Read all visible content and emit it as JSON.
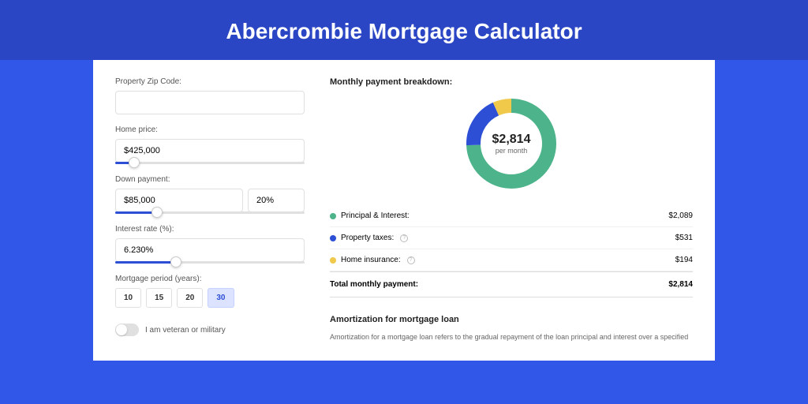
{
  "title": "Abercrombie Mortgage Calculator",
  "form": {
    "zip_label": "Property Zip Code:",
    "zip_value": "",
    "home_price_label": "Home price:",
    "home_price_value": "$425,000",
    "down_payment_label": "Down payment:",
    "down_payment_value": "$85,000",
    "down_payment_pct": "20%",
    "interest_label": "Interest rate (%):",
    "interest_value": "6.230%",
    "period_label": "Mortgage period (years):",
    "periods": [
      "10",
      "15",
      "20",
      "30"
    ],
    "period_selected": "30",
    "veteran_label": "I am veteran or military"
  },
  "breakdown": {
    "title": "Monthly payment breakdown:",
    "amount": "$2,814",
    "per": "per month",
    "items": [
      {
        "label": "Principal & Interest:",
        "value": "$2,089",
        "color": "#4db38a"
      },
      {
        "label": "Property taxes:",
        "value": "$531",
        "color": "#2d4fd6",
        "info": true
      },
      {
        "label": "Home insurance:",
        "value": "$194",
        "color": "#f0c94a",
        "info": true
      }
    ],
    "total_label": "Total monthly payment:",
    "total_value": "$2,814"
  },
  "amort": {
    "title": "Amortization for mortgage loan",
    "text": "Amortization for a mortgage loan refers to the gradual repayment of the loan principal and interest over a specified"
  },
  "chart_data": {
    "type": "pie",
    "title": "Monthly payment breakdown",
    "series": [
      {
        "name": "Principal & Interest",
        "value": 2089,
        "color": "#4db38a"
      },
      {
        "name": "Property taxes",
        "value": 531,
        "color": "#2d4fd6"
      },
      {
        "name": "Home insurance",
        "value": 194,
        "color": "#f0c94a"
      }
    ],
    "total": 2814,
    "center_label": "$2,814 per month"
  }
}
